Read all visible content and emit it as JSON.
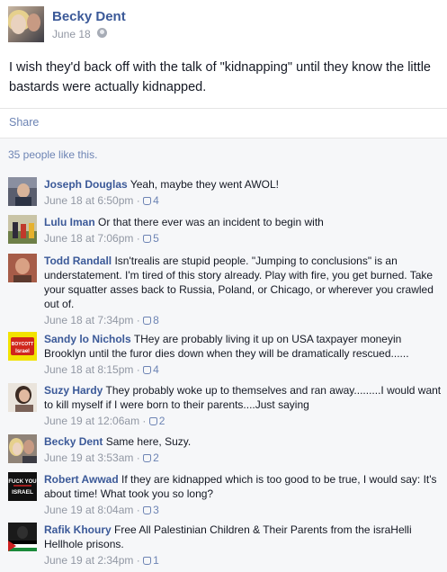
{
  "post": {
    "author": "Becky Dent",
    "date": "June 18",
    "text": "I wish they'd back off with the talk of \"kidnapping\" until they know the little bastards were actually kidnapped.",
    "share_label": "Share",
    "likes": "35 people like this."
  },
  "comments": [
    {
      "name": "Joseph Douglas",
      "text": "Yeah, maybe they went AWOL!",
      "time": "June 18 at 6:50pm",
      "likes": "4"
    },
    {
      "name": "Lulu Iman",
      "text": "Or that there ever was an incident to begin with",
      "time": "June 18 at 7:06pm",
      "likes": "5"
    },
    {
      "name": "Todd Randall",
      "text": "Isn'trealis are stupid people. \"Jumping to conclusions\" is an understatement. I'm tired of this story already. Play with fire, you get burned. Take your squatter asses back to Russia, Poland, or Chicago, or wherever you crawled out of.",
      "time": "June 18 at 7:34pm",
      "likes": "8"
    },
    {
      "name": "Sandy lo Nichols",
      "text": "THey are probably living it up on USA taxpayer moneyin Brooklyn until the furor dies down when they will be dramatically rescued......",
      "time": "June 18 at 8:15pm",
      "likes": "4"
    },
    {
      "name": "Suzy Hardy",
      "text": "They probably woke up to themselves and ran away.........I would want to kill myself if I were born to their parents....Just saying",
      "time": "June 19 at 12:06am",
      "likes": "2"
    },
    {
      "name": "Becky Dent",
      "text": "Same here, Suzy.",
      "time": "June 19 at 3:53am",
      "likes": "2"
    },
    {
      "name": "Robert Awwad",
      "text": "If they are kidnapped which is too good to be true, I would say: It's about time! What took you so long?",
      "time": "June 19 at 8:04am",
      "likes": "3"
    },
    {
      "name": "Rafik Khoury",
      "text": "Free All Palestinian Children & Their Parents from the israHelli Hellhole prisons.",
      "time": "June 19 at 2:34pm",
      "likes": "1"
    }
  ],
  "avatar_text": {
    "sandy": [
      "BOYCOTT",
      "Israel"
    ],
    "robert": [
      "FUCK YOU",
      "ISRAEL"
    ]
  },
  "colors": {
    "link": "#3b5998",
    "meta": "#9197a3",
    "panel": "#f6f7f9"
  }
}
